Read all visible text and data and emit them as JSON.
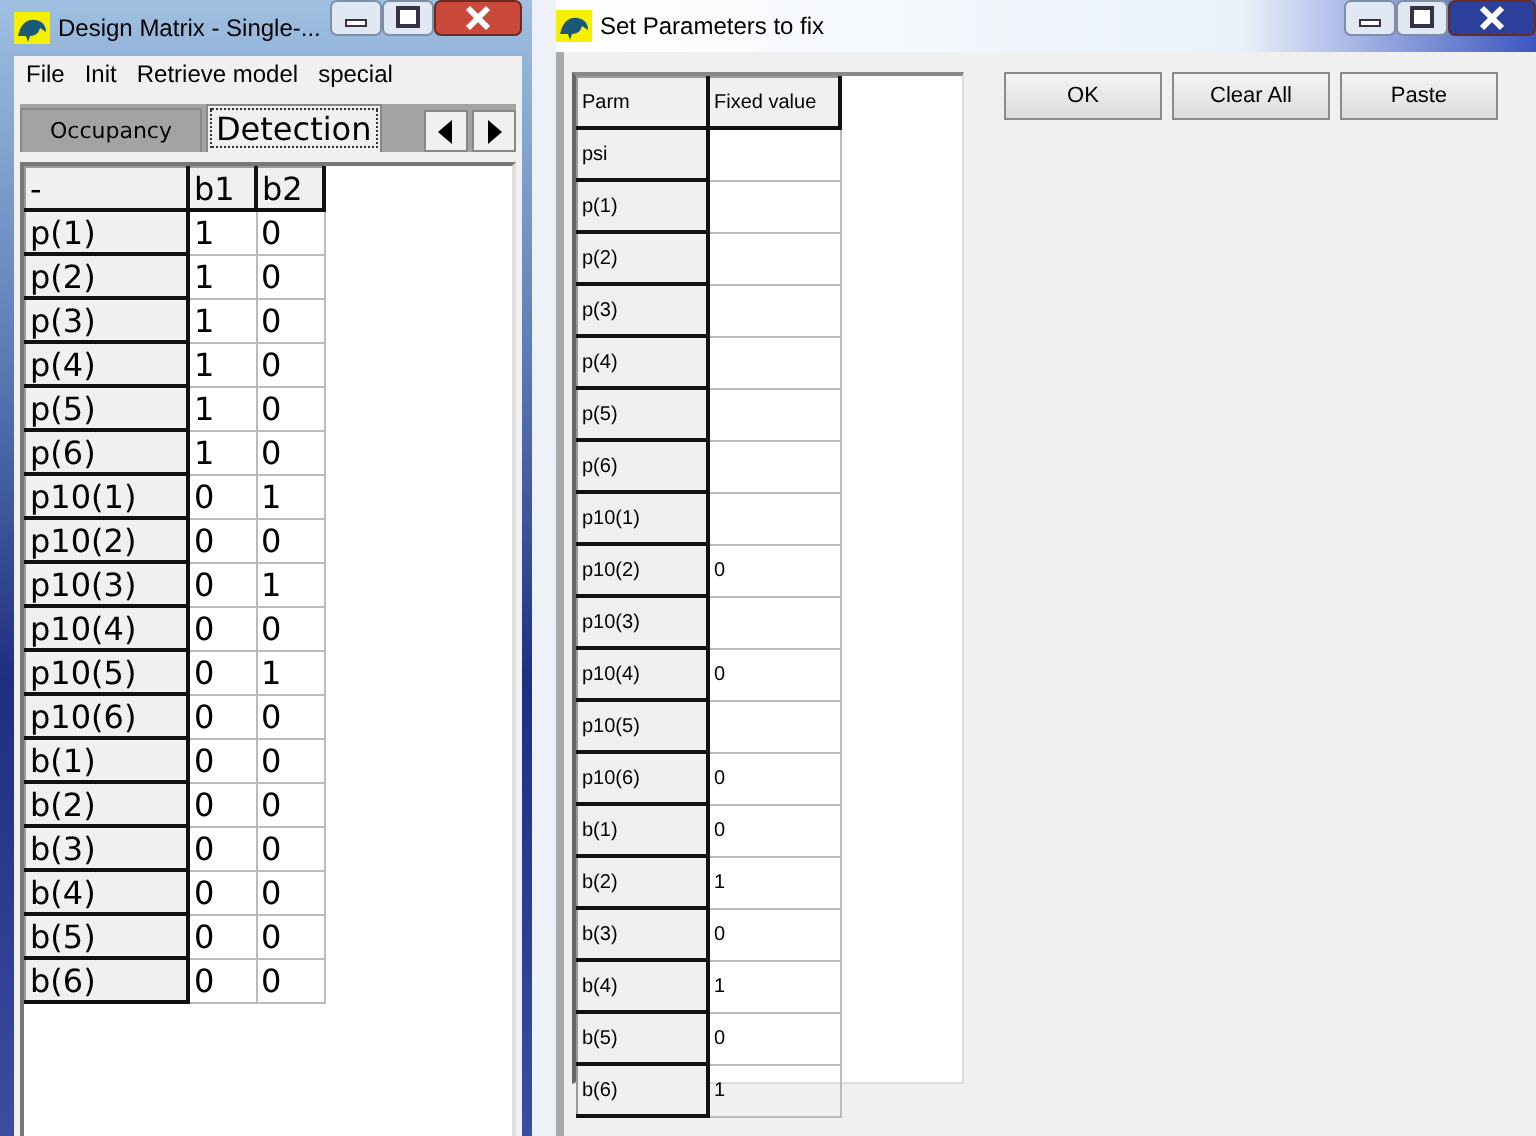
{
  "design_window": {
    "title": "Design Matrix - Single-...",
    "menu": [
      "File",
      "Init",
      "Retrieve model",
      "special"
    ],
    "tabs": [
      {
        "label": "Occupancy",
        "selected": false
      },
      {
        "label": "Detection",
        "selected": true
      }
    ],
    "columns": [
      "-",
      "b1",
      "b2"
    ],
    "rows": [
      {
        "label": "p(1)",
        "values": [
          "1",
          "0"
        ]
      },
      {
        "label": "p(2)",
        "values": [
          "1",
          "0"
        ]
      },
      {
        "label": "p(3)",
        "values": [
          "1",
          "0"
        ]
      },
      {
        "label": "p(4)",
        "values": [
          "1",
          "0"
        ]
      },
      {
        "label": "p(5)",
        "values": [
          "1",
          "0"
        ]
      },
      {
        "label": "p(6)",
        "values": [
          "1",
          "0"
        ]
      },
      {
        "label": "p10(1)",
        "values": [
          "0",
          "1"
        ]
      },
      {
        "label": "p10(2)",
        "values": [
          "0",
          "0"
        ]
      },
      {
        "label": "p10(3)",
        "values": [
          "0",
          "1"
        ]
      },
      {
        "label": "p10(4)",
        "values": [
          "0",
          "0"
        ]
      },
      {
        "label": "p10(5)",
        "values": [
          "0",
          "1"
        ]
      },
      {
        "label": "p10(6)",
        "values": [
          "0",
          "0"
        ]
      },
      {
        "label": "b(1)",
        "values": [
          "0",
          "0"
        ]
      },
      {
        "label": "b(2)",
        "values": [
          "0",
          "0"
        ]
      },
      {
        "label": "b(3)",
        "values": [
          "0",
          "0"
        ]
      },
      {
        "label": "b(4)",
        "values": [
          "0",
          "0"
        ]
      },
      {
        "label": "b(5)",
        "values": [
          "0",
          "0"
        ]
      },
      {
        "label": "b(6)",
        "values": [
          "0",
          "0"
        ]
      }
    ]
  },
  "fix_window": {
    "title": "Set Parameters to fix",
    "columns": [
      "Parm",
      "Fixed value"
    ],
    "rows": [
      {
        "label": "psi"
      },
      {
        "label": "p(1)"
      },
      {
        "label": "p(2)"
      },
      {
        "label": "p(3)"
      },
      {
        "label": "p(4)"
      },
      {
        "label": "p(5)"
      },
      {
        "label": "p(6)"
      },
      {
        "label": "p10(1)"
      },
      {
        "label": "p10(2)",
        "value": "0"
      },
      {
        "label": "p10(3)"
      },
      {
        "label": "p10(4)",
        "value": "0"
      },
      {
        "label": "p10(5)"
      },
      {
        "label": "p10(6)",
        "value": "0"
      },
      {
        "label": "b(1)",
        "value": "0"
      },
      {
        "label": "b(2)",
        "value": "1"
      },
      {
        "label": "b(3)",
        "value": "0"
      },
      {
        "label": "b(4)",
        "value": "1"
      },
      {
        "label": "b(5)",
        "value": "0"
      },
      {
        "label": "b(6)",
        "value": "1"
      }
    ],
    "buttons": [
      "OK",
      "Clear All",
      "Paste"
    ]
  }
}
